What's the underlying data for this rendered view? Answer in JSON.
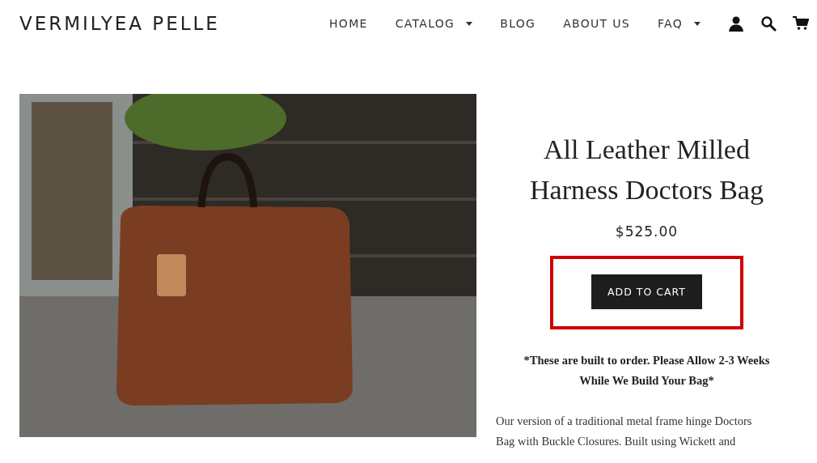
{
  "header": {
    "logo": "VERMILYEA PELLE",
    "nav": [
      {
        "label": "HOME",
        "dropdown": false
      },
      {
        "label": "CATALOG",
        "dropdown": true
      },
      {
        "label": "BLOG",
        "dropdown": false
      },
      {
        "label": "ABOUT US",
        "dropdown": false
      },
      {
        "label": "FAQ",
        "dropdown": true
      }
    ]
  },
  "product": {
    "title": "All Leather Milled Harness Doctors Bag",
    "price": "$525.00",
    "add_to_cart": {
      "label": "ADD TO CART",
      "highlighted": true
    },
    "notice": "*These are built to order.  Please Allow 2-3 Weeks While We Build Your Bag*",
    "description": "Our version of a traditional metal frame hinge Doctors\nBag with Buckle Closures.  Built using Wickett and"
  }
}
